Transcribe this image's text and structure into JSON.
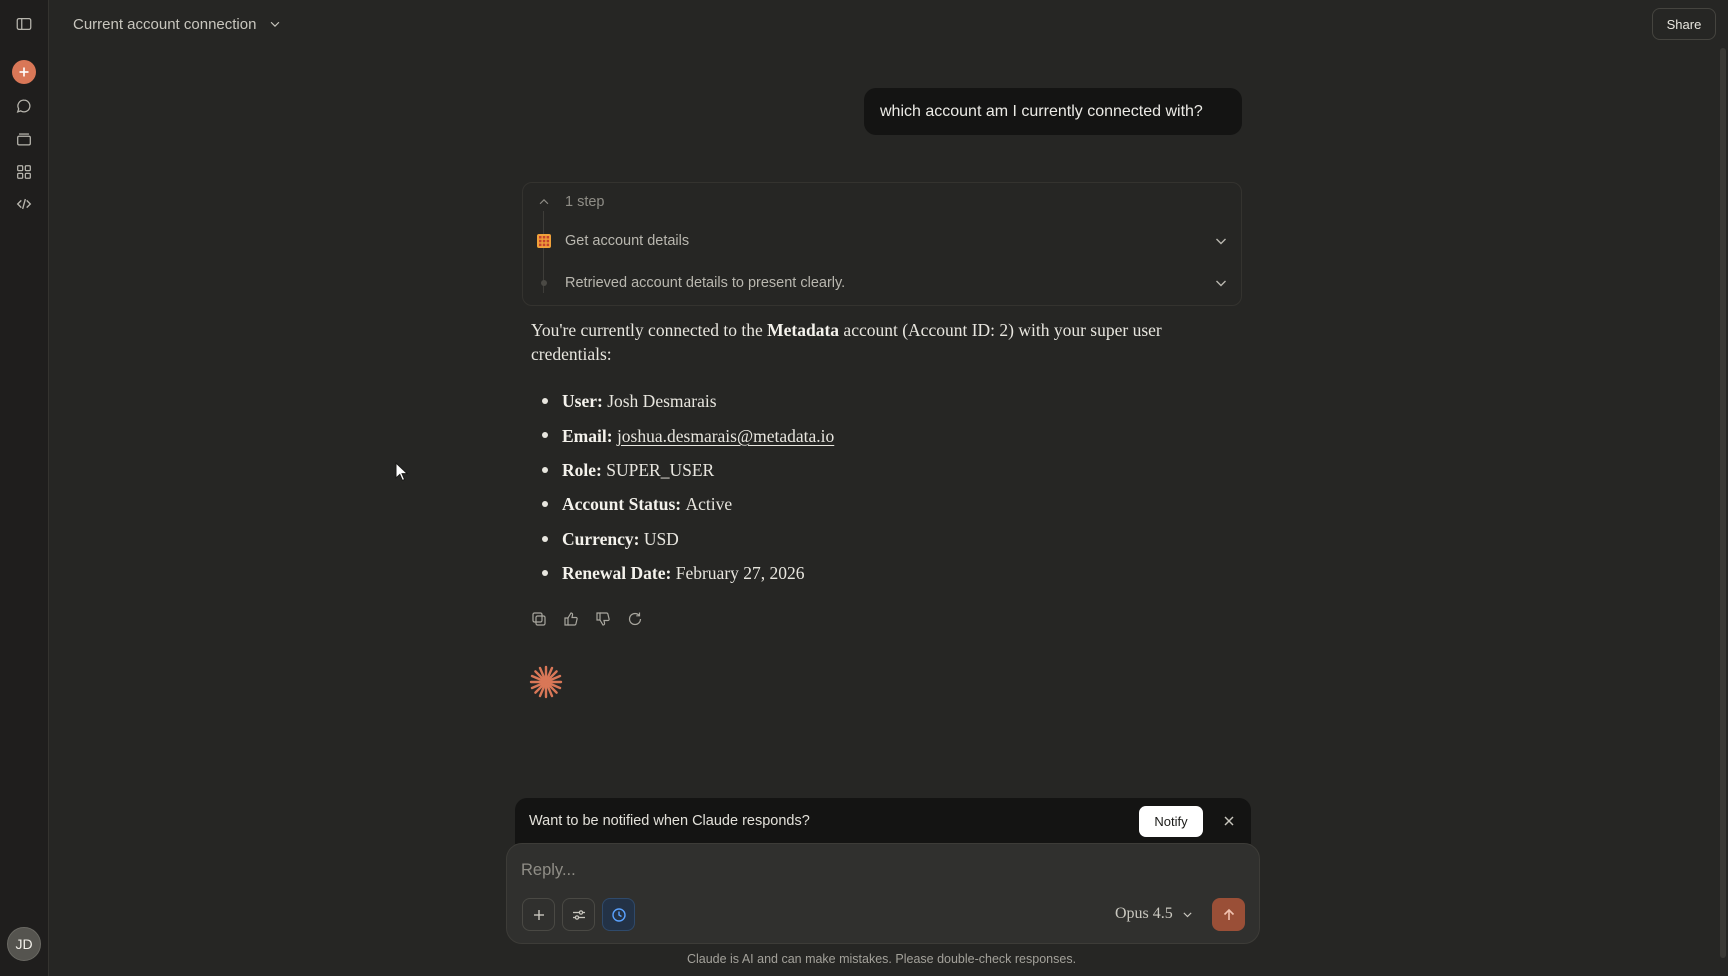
{
  "header": {
    "title": "Current account connection",
    "share_label": "Share"
  },
  "sidebar": {
    "items": [
      {
        "name": "toggle-sidebar",
        "icon": "sidebar-icon"
      },
      {
        "name": "new-chat",
        "icon": "plus-icon"
      },
      {
        "name": "chats",
        "icon": "chat-bubble-icon"
      },
      {
        "name": "projects",
        "icon": "folder-stack-icon"
      },
      {
        "name": "artifacts",
        "icon": "grid-icon"
      },
      {
        "name": "code",
        "icon": "code-icon"
      }
    ],
    "avatar_initials": "JD"
  },
  "conversation": {
    "user_message": "which account am I currently connected with?",
    "steps": {
      "count_label": "1 step",
      "tool_label": "Get account details",
      "summary_label": "Retrieved account details to present clearly."
    },
    "answer": {
      "intro_prefix": "You're currently connected to the ",
      "intro_bold": "Metadata",
      "intro_suffix": " account (Account ID: 2) with your super user credentials:",
      "items": [
        {
          "label": "User:",
          "value": "Josh Desmarais"
        },
        {
          "label": "Email:",
          "value": "joshua.desmarais@metadata.io"
        },
        {
          "label": "Role:",
          "value": "SUPER_USER"
        },
        {
          "label": "Account Status:",
          "value": "Active"
        },
        {
          "label": "Currency:",
          "value": "USD"
        },
        {
          "label": "Renewal Date:",
          "value": "February 27, 2026"
        }
      ]
    }
  },
  "notify_bar": {
    "text": "Want to be notified when Claude responds?",
    "button_label": "Notify"
  },
  "composer": {
    "placeholder": "Reply...",
    "model_label": "Opus 4.5"
  },
  "footer": {
    "disclaimer": "Claude is AI and can make mistakes. Please double-check responses."
  },
  "colors": {
    "background": "#262624",
    "accent": "#d97757",
    "send_button": "#9a4f37"
  }
}
